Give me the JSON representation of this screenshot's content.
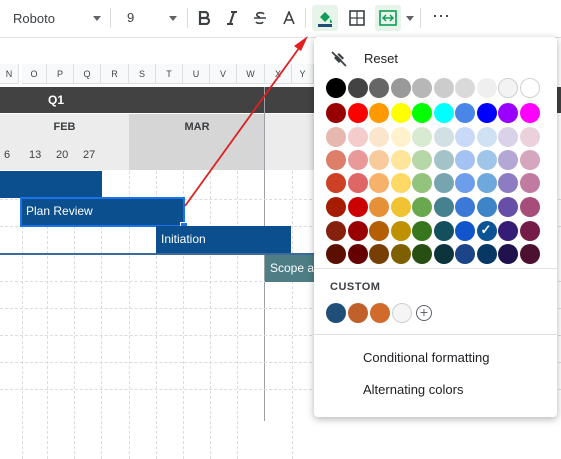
{
  "toolbar": {
    "font": "Roboto",
    "size": "9",
    "more": "⋯"
  },
  "sheet": {
    "columns": [
      "N",
      "O",
      "P",
      "Q",
      "R",
      "S",
      "T",
      "U",
      "V",
      "W",
      "X",
      "Y"
    ],
    "quarter": "Q1",
    "months": [
      "FEB",
      "MAR"
    ],
    "days": [
      "6",
      "13",
      "20",
      "27"
    ],
    "bars": [
      {
        "label": "Plan Review"
      },
      {
        "label": "Initiation"
      },
      {
        "label": "Scope an"
      }
    ]
  },
  "menu": {
    "reset": "Reset",
    "custom_header": "CUSTOM",
    "conditional": "Conditional formatting",
    "alternating": "Alternating colors",
    "palette": [
      [
        "#000000",
        "#434343",
        "#666666",
        "#999999",
        "#b7b7b7",
        "#cccccc",
        "#d9d9d9",
        "#efefef",
        "#f3f3f3",
        "#ffffff"
      ],
      [
        "#980000",
        "#ff0000",
        "#ff9900",
        "#ffff00",
        "#00ff00",
        "#00ffff",
        "#4a86e8",
        "#0000ff",
        "#9900ff",
        "#ff00ff"
      ],
      [
        "#e6b8af",
        "#f4cccc",
        "#fce5cd",
        "#fff2cc",
        "#d9ead3",
        "#d0e0e3",
        "#c9daf8",
        "#cfe2f3",
        "#d9d2e9",
        "#ead1dc"
      ],
      [
        "#dd7e6b",
        "#ea9999",
        "#f9cb9c",
        "#ffe599",
        "#b6d7a8",
        "#a2c4c9",
        "#a4c2f4",
        "#9fc5e8",
        "#b4a7d6",
        "#d5a6bd"
      ],
      [
        "#cc4125",
        "#e06666",
        "#f6b26b",
        "#ffd966",
        "#93c47d",
        "#76a5af",
        "#6d9eeb",
        "#6fa8dc",
        "#8e7cc3",
        "#c27ba0"
      ],
      [
        "#a61c00",
        "#cc0000",
        "#e69138",
        "#f1c232",
        "#6aa84f",
        "#45818e",
        "#3c78d8",
        "#3d85c6",
        "#674ea7",
        "#a64d79"
      ],
      [
        "#85200c",
        "#990000",
        "#b45f06",
        "#bf9000",
        "#38761d",
        "#134f5c",
        "#1155cc",
        "#0b5394",
        "#351c75",
        "#741b47"
      ],
      [
        "#5b0f00",
        "#660000",
        "#783f04",
        "#7f6000",
        "#274e13",
        "#0c343d",
        "#1c4587",
        "#073763",
        "#20124d",
        "#4c1130"
      ]
    ],
    "custom_colors": [
      "#1f4e79",
      "#c0602a",
      "#d06b2c",
      "#f5f5f5"
    ],
    "add_custom": "+",
    "check": "✓"
  }
}
